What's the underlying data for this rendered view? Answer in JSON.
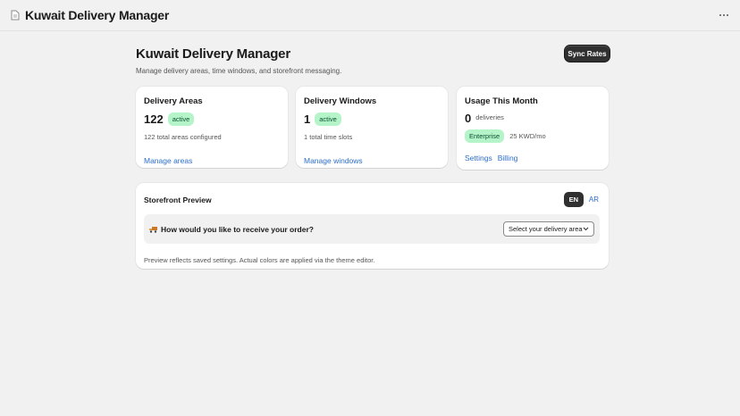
{
  "topbar": {
    "app_icon": "document-icon",
    "title": "Kuwait Delivery Manager",
    "more_icon": "ellipsis-icon"
  },
  "header": {
    "title": "Kuwait Delivery Manager",
    "subtitle": "Manage delivery areas, time windows, and storefront messaging.",
    "sync_button": "Sync Rates"
  },
  "cards": {
    "areas": {
      "title": "Delivery Areas",
      "count": "122",
      "status": "active",
      "note": "122 total areas configured",
      "link": "Manage areas"
    },
    "windows": {
      "title": "Delivery Windows",
      "count": "1",
      "status": "active",
      "note": "1 total time slots",
      "link": "Manage windows"
    },
    "usage": {
      "title": "Usage This Month",
      "count": "0",
      "unit": "deliveries",
      "plan": "Enterprise",
      "price": "25 KWD/mo",
      "links": [
        "Settings",
        "Billing"
      ]
    }
  },
  "preview": {
    "title": "Storefront Preview",
    "languages": [
      "EN",
      "AR"
    ],
    "active_language": "EN",
    "truck_icon": "delivery-truck-icon",
    "question": "How would you like to receive your order?",
    "select_value": "Select your delivery area",
    "note": "Preview reflects saved settings. Actual colors are applied via the theme editor."
  },
  "colors": {
    "background": "#f1f1f1",
    "card": "#ffffff",
    "primary_button": "#303030",
    "link": "#2c6ecb",
    "success_badge": "#b4f4c8"
  }
}
